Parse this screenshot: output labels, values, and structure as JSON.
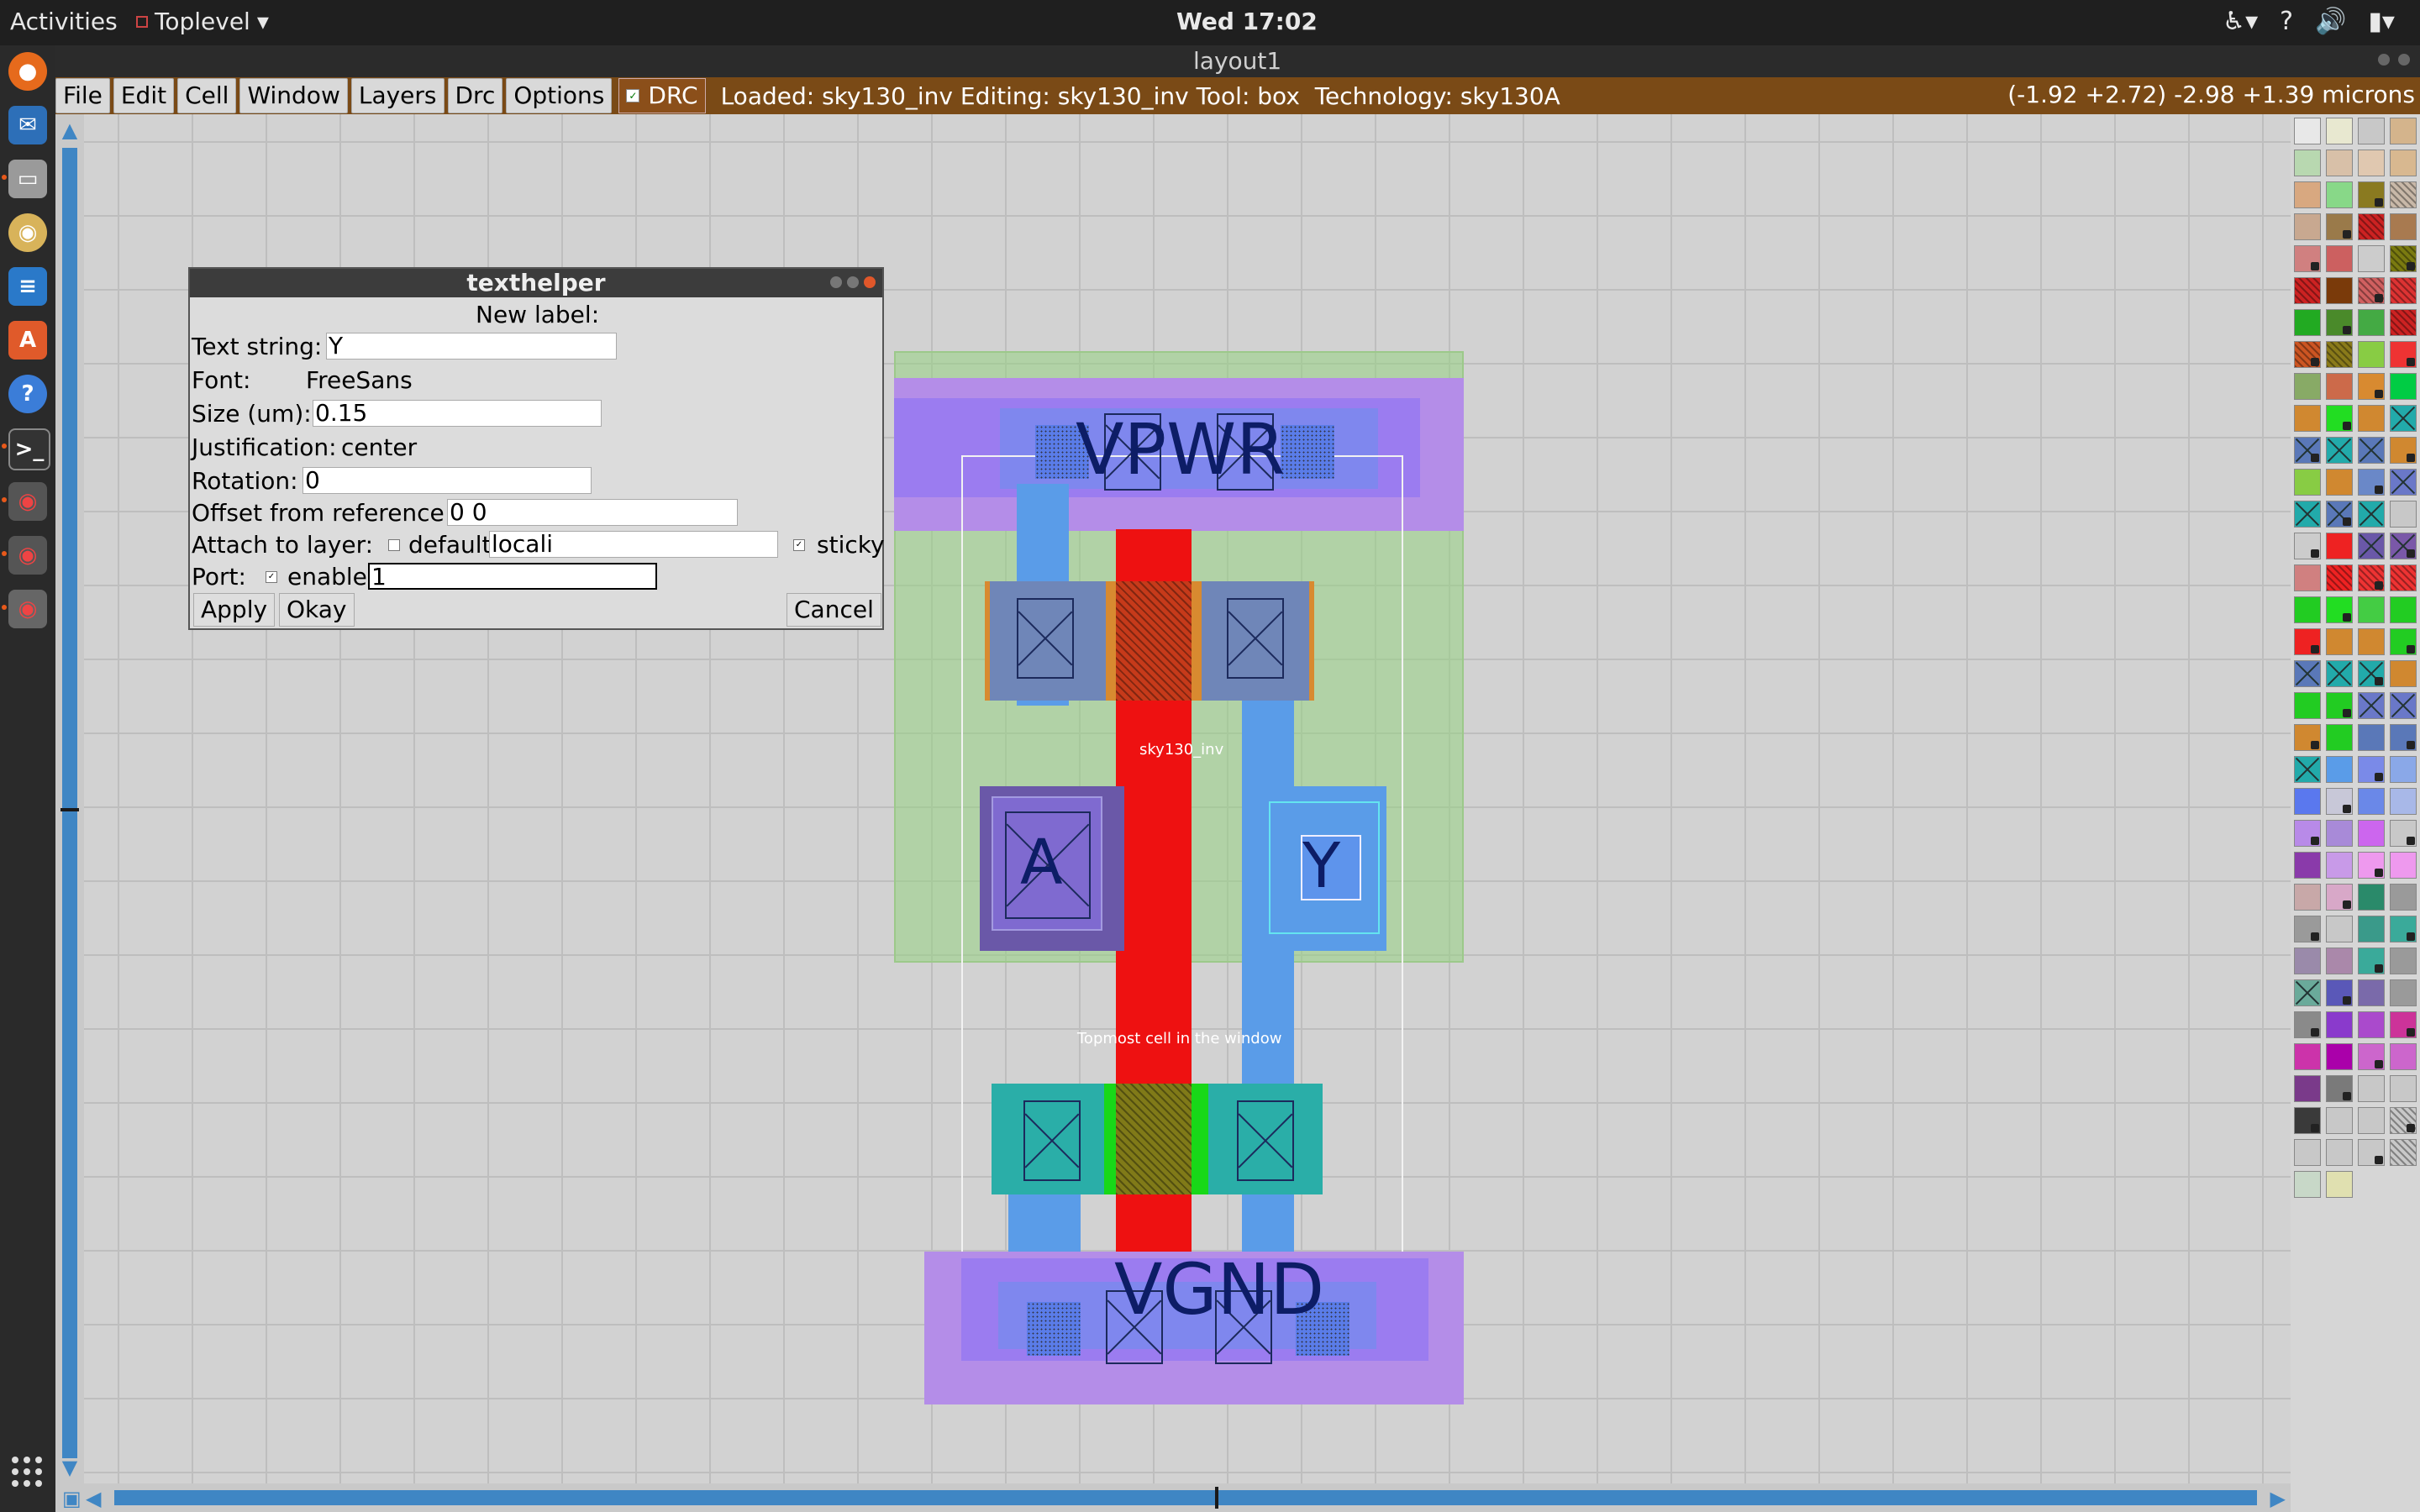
{
  "topbar": {
    "activities": "Activities",
    "app": "Toplevel",
    "clock": "Wed 17:02"
  },
  "window": {
    "title": "layout1"
  },
  "menubar": {
    "items": [
      "File",
      "Edit",
      "Cell",
      "Window",
      "Layers",
      "Drc",
      "Options"
    ],
    "drc": "DRC",
    "status": "Loaded: sky130_inv Editing: sky130_inv Tool: box  Technology: sky130A",
    "coords": "(-1.92 +2.72) -2.98 +1.39 microns"
  },
  "layout": {
    "labels": {
      "vpwr": "VPWR",
      "vgnd": "VGND",
      "a": "A",
      "y": "Y",
      "cell": "sky130_inv",
      "topmost": "Topmost cell in the window"
    }
  },
  "dialog": {
    "title": "texthelper",
    "heading": "New label:",
    "text_string_label": "Text string:",
    "text_string": "Y",
    "font_label": "Font:",
    "font": "FreeSans",
    "size_label": "Size (um):",
    "size": "0.15",
    "justification_label": "Justification:",
    "justification": "center",
    "rotation_label": "Rotation:",
    "rotation": "0",
    "offset_label": "Offset from reference:",
    "offset": "0 0",
    "attach_label": "Attach to layer:",
    "default_label": "default",
    "layer": "locali",
    "sticky_label": "sticky",
    "port_label": "Port:",
    "enable_label": "enable",
    "port_value": "1",
    "apply": "Apply",
    "okay": "Okay",
    "cancel": "Cancel"
  },
  "colors": {
    "menubar": "#7a4a16",
    "nwell": "#b7d9a8",
    "met1": "#9b7cf0",
    "poly": "#ee1111",
    "pdiff": "#d88a30",
    "ndiff": "#2aaea8",
    "locali": "#5a9ce8"
  }
}
